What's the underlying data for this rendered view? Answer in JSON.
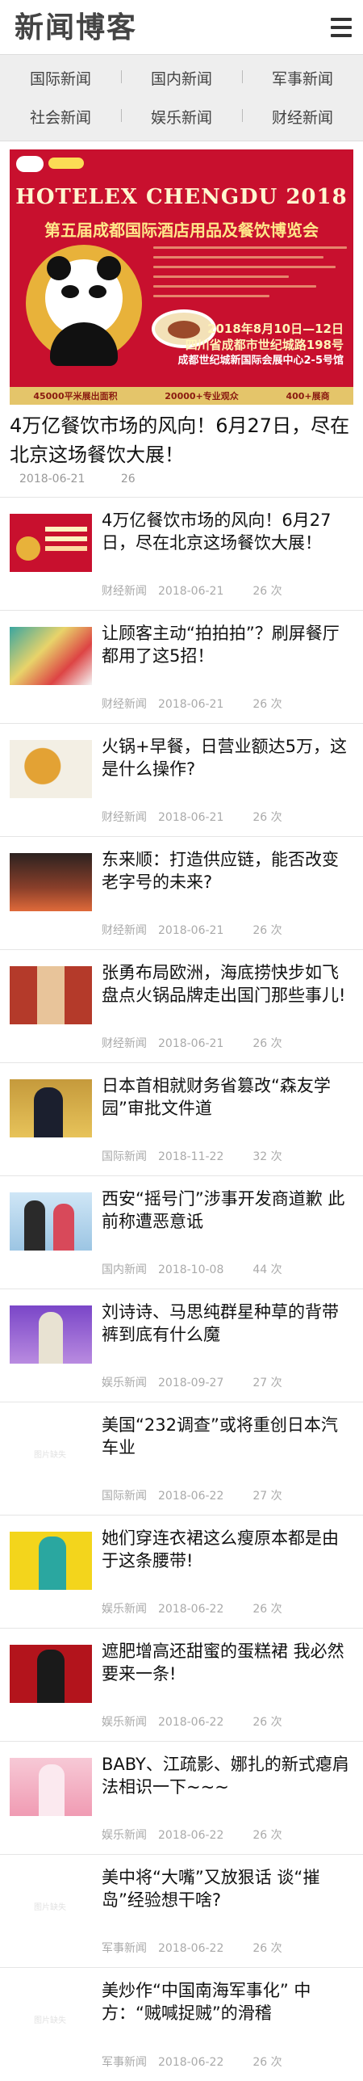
{
  "header": {
    "logo": "新闻博客",
    "menu_icon": "hamburger-menu-icon"
  },
  "nav": {
    "row1": [
      "国际新闻",
      "国内新闻",
      "军事新闻"
    ],
    "row2": [
      "社会新闻",
      "娱乐新闻",
      "财经新闻"
    ]
  },
  "featured": {
    "banner": {
      "title": "HOTELEX CHENGDU 2018",
      "subtitle": "第五届成都国际酒店用品及餐饮博览会",
      "date": "2018年8月10日—12日",
      "venue_line1": "四川省成都市世纪城路198号",
      "venue_line2": "成都世纪城新国际会展中心2-5号馆",
      "footer": [
        "45000平米展出面积",
        "20000+专业观众",
        "400+展商"
      ]
    },
    "title": "4万亿餐饮市场的风向！6月27日，尽在北京这场餐饮大展！",
    "date": "2018-06-21",
    "views": "26"
  },
  "news": [
    {
      "title": "4万亿餐饮市场的风向！6月27日，尽在北京这场餐饮大展！",
      "category": "财经新闻",
      "date": "2018-06-21",
      "views": "26 次"
    },
    {
      "title": "让顾客主动“拍拍拍”？刷屏餐厅都用了这5招！",
      "category": "财经新闻",
      "date": "2018-06-21",
      "views": "26 次"
    },
    {
      "title": "火锅+早餐，日营业额达5万，这是什么操作?",
      "category": "财经新闻",
      "date": "2018-06-21",
      "views": "26 次"
    },
    {
      "title": "东来顺：打造供应链，能否改变老字号的未来?",
      "category": "财经新闻",
      "date": "2018-06-21",
      "views": "26 次"
    },
    {
      "title": "张勇布局欧洲，海底捞快步如飞 盘点火锅品牌走出国门那些事儿!",
      "category": "财经新闻",
      "date": "2018-06-21",
      "views": "26 次"
    },
    {
      "title": "日本首相就财务省篡改“森友学园”审批文件道",
      "category": "国际新闻",
      "date": "2018-11-22",
      "views": "32 次"
    },
    {
      "title": "西安“摇号门”涉事开发商道歉 此前称遭恶意诋",
      "category": "国内新闻",
      "date": "2018-10-08",
      "views": "44 次"
    },
    {
      "title": "刘诗诗、马思纯群星种草的背带裤到底有什么魔",
      "category": "娱乐新闻",
      "date": "2018-09-27",
      "views": "27 次"
    },
    {
      "title": "美国“232调查”或将重创日本汽车业",
      "category": "国际新闻",
      "date": "2018-06-22",
      "views": "27 次",
      "placeholder": "图片缺失"
    },
    {
      "title": "她们穿连衣裙这么瘦原本都是由于这条腰带!",
      "category": "娱乐新闻",
      "date": "2018-06-22",
      "views": "26 次"
    },
    {
      "title": "遮肥增高还甜蜜的蛋糕裙 我必然要来一条!",
      "category": "娱乐新闻",
      "date": "2018-06-22",
      "views": "26 次"
    },
    {
      "title": "BABY、江疏影、娜扎的新式瘪肩法相识一下~~~",
      "category": "娱乐新闻",
      "date": "2018-06-22",
      "views": "26 次"
    },
    {
      "title": "美中将“大嘴”又放狠话 谈“摧岛”经验想干啥?",
      "category": "军事新闻",
      "date": "2018-06-22",
      "views": "26 次",
      "placeholder": "图片缺失"
    },
    {
      "title": "美炒作“中国南海军事化” 中方：“贼喊捉贼”的滑稽",
      "category": "军事新闻",
      "date": "2018-06-22",
      "views": "26 次",
      "placeholder": "图片缺失"
    }
  ]
}
